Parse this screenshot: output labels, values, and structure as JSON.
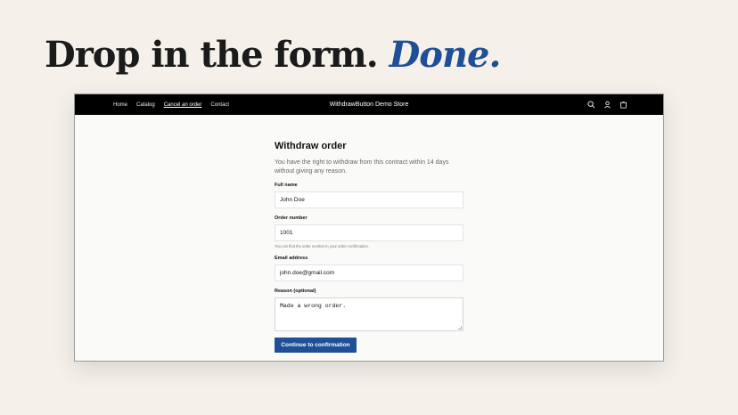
{
  "headline": {
    "main": "Drop in the form. ",
    "accent": "Done."
  },
  "store": {
    "nav": [
      "Home",
      "Catalog",
      "Cancel an order",
      "Contact"
    ],
    "active_nav": "Cancel an order",
    "title": "WithdrawButton Demo Store",
    "icons": [
      "search-icon",
      "account-icon",
      "cart-icon"
    ]
  },
  "form": {
    "heading": "Withdraw order",
    "intro": "You have the right to withdraw from this contract within 14 days without giving any reason.",
    "full_name": {
      "label": "Full name",
      "value": "John Doe"
    },
    "order_number": {
      "label": "Order number",
      "value": "1001",
      "help": "You can find the order number in your order confirmation."
    },
    "email": {
      "label": "Email address",
      "value": "john.doe@gmail.com"
    },
    "reason": {
      "label": "Reason (optional)",
      "value": "Made a wrong order."
    },
    "submit_label": "Continue to confirmation"
  },
  "colors": {
    "accent": "#1f4f97",
    "background": "#f5f1ea",
    "topbar": "#000000"
  }
}
